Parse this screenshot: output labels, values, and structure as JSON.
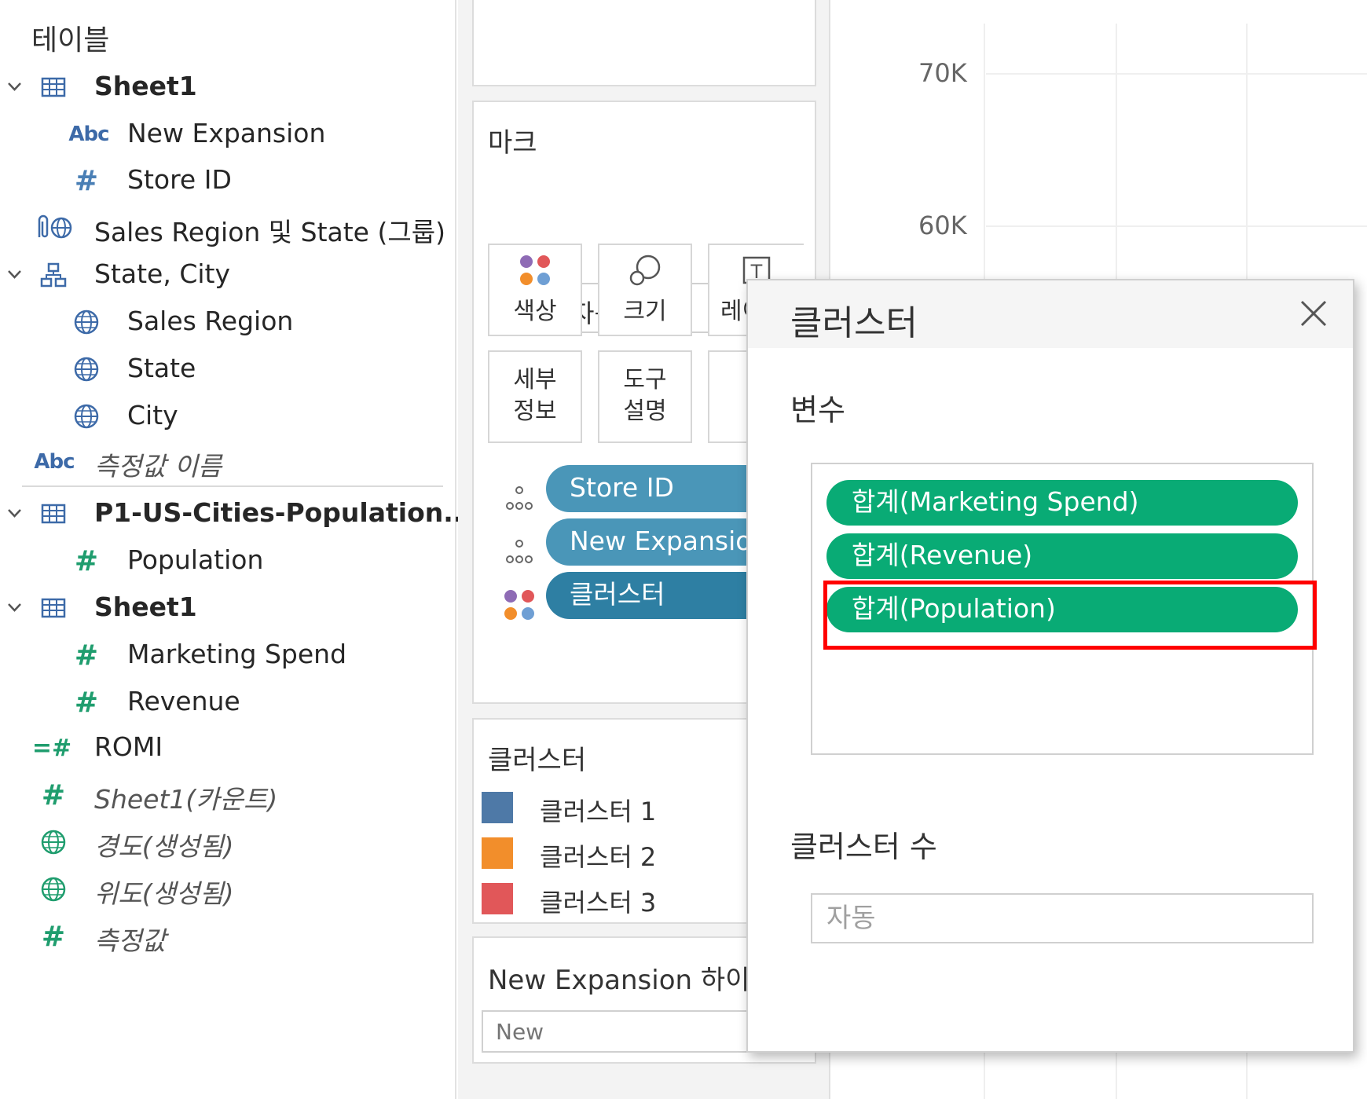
{
  "data_pane": {
    "title": "테이블",
    "items": [
      {
        "label": "Sheet1",
        "icon": "table-icon"
      },
      {
        "label": "New Expansion",
        "icon": "abc-icon"
      },
      {
        "label": "Store ID",
        "icon": "hash-icon"
      },
      {
        "label": "Sales Region 및 State (그룹)",
        "icon": "paperclip-globe-icon"
      },
      {
        "label": "State, City",
        "icon": "hierarchy-icon"
      },
      {
        "label": "Sales Region",
        "icon": "globe-icon"
      },
      {
        "label": "State",
        "icon": "globe-icon"
      },
      {
        "label": "City",
        "icon": "globe-icon"
      },
      {
        "label": "측정값 이름",
        "icon": "abc-icon"
      },
      {
        "label": "P1-US-Cities-Population....",
        "icon": "table-icon"
      },
      {
        "label": "Population",
        "icon": "hash-icon"
      },
      {
        "label": "Sheet1",
        "icon": "table-icon"
      },
      {
        "label": "Marketing Spend",
        "icon": "hash-icon"
      },
      {
        "label": "Revenue",
        "icon": "hash-icon"
      },
      {
        "label": "ROMI",
        "icon": "calc-hash-icon"
      },
      {
        "label": "Sheet1(카운트)",
        "icon": "hash-icon"
      },
      {
        "label": "경도(생성됨)",
        "icon": "globe-icon"
      },
      {
        "label": "위도(생성됨)",
        "icon": "globe-icon"
      },
      {
        "label": "측정값",
        "icon": "hash-icon"
      }
    ],
    "icon_glyphs": {
      "abc": "Abc",
      "hash": "#",
      "calc": "=#"
    }
  },
  "marks": {
    "title": "마크",
    "type": "자동",
    "buttons": {
      "color": "색상",
      "size": "크기",
      "label": "레이",
      "detail_1": "세부",
      "detail_2": "정보",
      "tooltip_1": "도구",
      "tooltip_2": "설명"
    },
    "pills": [
      "Store ID",
      "New Expansion",
      "클러스터"
    ]
  },
  "legend": {
    "title": "클러스터",
    "items": [
      {
        "label": "클러스터 1",
        "color": "#4e79a7"
      },
      {
        "label": "클러스터 2",
        "color": "#f28e2b"
      },
      {
        "label": "클러스터 3",
        "color": "#e15759"
      }
    ]
  },
  "highlight_card": {
    "title": "New Expansion 하이",
    "placeholder": "New"
  },
  "axis": {
    "ticks": [
      "70K",
      "60K"
    ]
  },
  "dialog": {
    "title": "클러스터",
    "variables_label": "변수",
    "variables": [
      "합계(Marketing Spend)",
      "합계(Revenue)",
      "합계(Population)"
    ],
    "num_clusters_label": "클러스터 수",
    "num_clusters_placeholder": "자동"
  },
  "colors": {
    "measure_pill": "#09ab75",
    "dimension_pill": "#4a96b8",
    "cluster_pill": "#2e7fa3",
    "highlight_border": "#ff0000"
  }
}
